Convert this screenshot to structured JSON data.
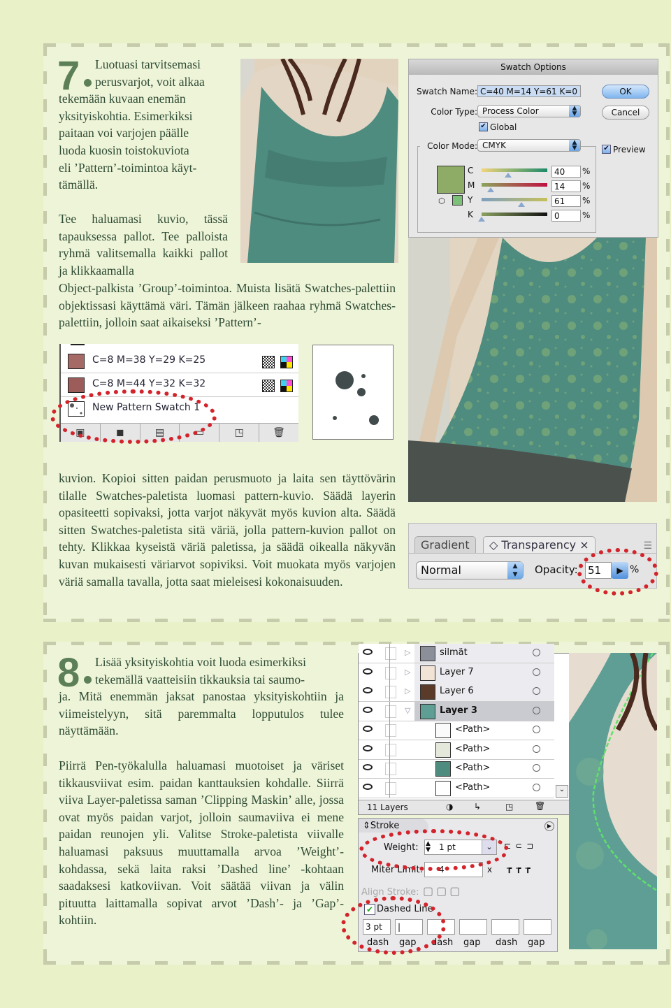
{
  "step7": {
    "number": "7",
    "intro_lines": [
      "Luotuasi tarvitsemasi",
      "perusvarjot, voit alkaa",
      "tekemään kuvaan enemän",
      "yksityiskohtia. Esimerkiksi",
      "paitaan voi varjojen päälle",
      "luoda kuosin toistokuviota",
      "eli ’Pattern’-toimintoa käyt-",
      "tämällä."
    ],
    "para2_narrow": "Tee haluamasi kuvio, tässä tapauksessa pallot. Tee palloista ryhmä valitsemalla kaikki pallot ja klikkaamalla",
    "para2_wide": "Object-palkista ’Group’-toimintoa. Muista lisätä Swatches-palettiin objektissasi käyttämä väri. Tämän jälkeen raahaa ryhmä Swatches-palettiin, jolloin saat aikaiseksi ’Pattern’-",
    "para3": "kuvion. Kopioi sitten paidan perusmuoto ja laita sen täyttövärin tilalle Swatches-paletista luomasi pattern-kuvio. Säädä layerin opasiteetti sopivaksi, jotta varjot näkyvät myös kuvion alta. Säädä sitten Swatches-paletista sitä väriä, jolla pattern-kuvion pallot on tehty. Klikkaa kyseistä väriä paletissa, ja säädä oikealla näkyvän kuvan mukaisesti väriarvot sopiviksi. Voit muokata myös varjojen väriä samalla tavalla, jotta saat mieleisesi kokonaisuuden."
  },
  "swatch_options": {
    "title": "Swatch Options",
    "swatch_name_label": "Swatch Name:",
    "swatch_name_value": "C=40 M=14 Y=61 K=0",
    "color_type_label": "Color Type:",
    "color_type_value": "Process Color",
    "global_label": "Global",
    "global_checked": true,
    "color_mode_label": "Color Mode:",
    "color_mode_value": "CMYK",
    "preview_label": "Preview",
    "preview_checked": true,
    "ok_label": "OK",
    "cancel_label": "Cancel",
    "swatch_color": "#8fac66",
    "channels": [
      {
        "label": "C",
        "value": "40",
        "unit": "%",
        "fraction": 0.4
      },
      {
        "label": "M",
        "value": "14",
        "unit": "%",
        "fraction": 0.14
      },
      {
        "label": "Y",
        "value": "61",
        "unit": "%",
        "fraction": 0.61
      },
      {
        "label": "K",
        "value": "0",
        "unit": "%",
        "fraction": 0.0
      }
    ]
  },
  "swatches_panel": {
    "rows": [
      {
        "name": "C=8 M=38 Y=29 K=25",
        "color": "#a66a66"
      },
      {
        "name": "C=8 M=44 Y=32 K=32",
        "color": "#9b5c5a"
      },
      {
        "name": "New Pattern Swatch 1",
        "color": "#ffffff"
      }
    ]
  },
  "transparency_panel": {
    "tabs": [
      {
        "label": "Gradient"
      },
      {
        "label": "◇ Transparency ×"
      }
    ],
    "blend_mode": "Normal",
    "opacity_label": "Opacity:",
    "opacity_value": "51",
    "opacity_unit": "%"
  },
  "step8": {
    "number": "8",
    "intro_lines": [
      "Lisää yksityiskohtia voit luoda esimerkiksi",
      "tekemällä vaatteisiin tikkauksia tai saumo-"
    ],
    "intro_rest": "ja. Mitä enemmän jaksat panostaa yksityiskohtiin ja viimeistelyyn, sitä paremmalta lopputulos tulee näyttämään.",
    "para2": "Piirrä Pen-työkalulla haluamasi muotoiset ja väriset tikkausviivat esim. paidan kanttauksien kohdalle.  Siirrä viiva Layer-paletissa saman ’Clipping Maskin’ alle, jossa ovat myös paidan varjot, jolloin saumaviiva ei mene paidan reunojen yli. Valitse Stroke-paletista viivalle haluamasi paksuus muuttamalla arvoa ’Weight’-kohdassa, sekä laita raksi ’Dashed line’ -kohtaan saadaksesi katkoviivan. Voit säätää viivan ja välin pituutta laittamalla sopivat arvot ’Dash’- ja ’Gap’-kohtiin."
  },
  "layers_panel": {
    "rows": [
      {
        "name": "silmät",
        "indent": 0,
        "expanded": false
      },
      {
        "name": "Layer 7",
        "indent": 0,
        "expanded": false
      },
      {
        "name": "Layer 6",
        "indent": 0,
        "expanded": false
      },
      {
        "name": "Layer 3",
        "indent": 0,
        "expanded": true,
        "selected": true
      },
      {
        "name": "<Path>",
        "indent": 1
      },
      {
        "name": "<Path>",
        "indent": 1
      },
      {
        "name": "<Path>",
        "indent": 1
      },
      {
        "name": "<Path>",
        "indent": 1
      }
    ],
    "footer_count": "11 Layers"
  },
  "stroke_panel": {
    "title": "Stroke",
    "weight_label": "Weight:",
    "weight_value": "1 pt",
    "miter_label": "Miter Limit:",
    "miter_value": "4",
    "miter_unit": "x",
    "align_label": "Align Stroke:",
    "dashed_label": "Dashed Line",
    "dashed_checked": true,
    "dash_fields": [
      {
        "label": "dash",
        "value": "3 pt"
      },
      {
        "label": "gap",
        "value": ""
      },
      {
        "label": "dash",
        "value": ""
      },
      {
        "label": "gap",
        "value": ""
      },
      {
        "label": "dash",
        "value": ""
      },
      {
        "label": "gap",
        "value": ""
      }
    ]
  },
  "colors": {
    "accent_green": "#5d7f58",
    "highlight_red": "#d3232b",
    "shirt_teal": "#4e8c80",
    "page_bg": "#e8f1c8"
  }
}
